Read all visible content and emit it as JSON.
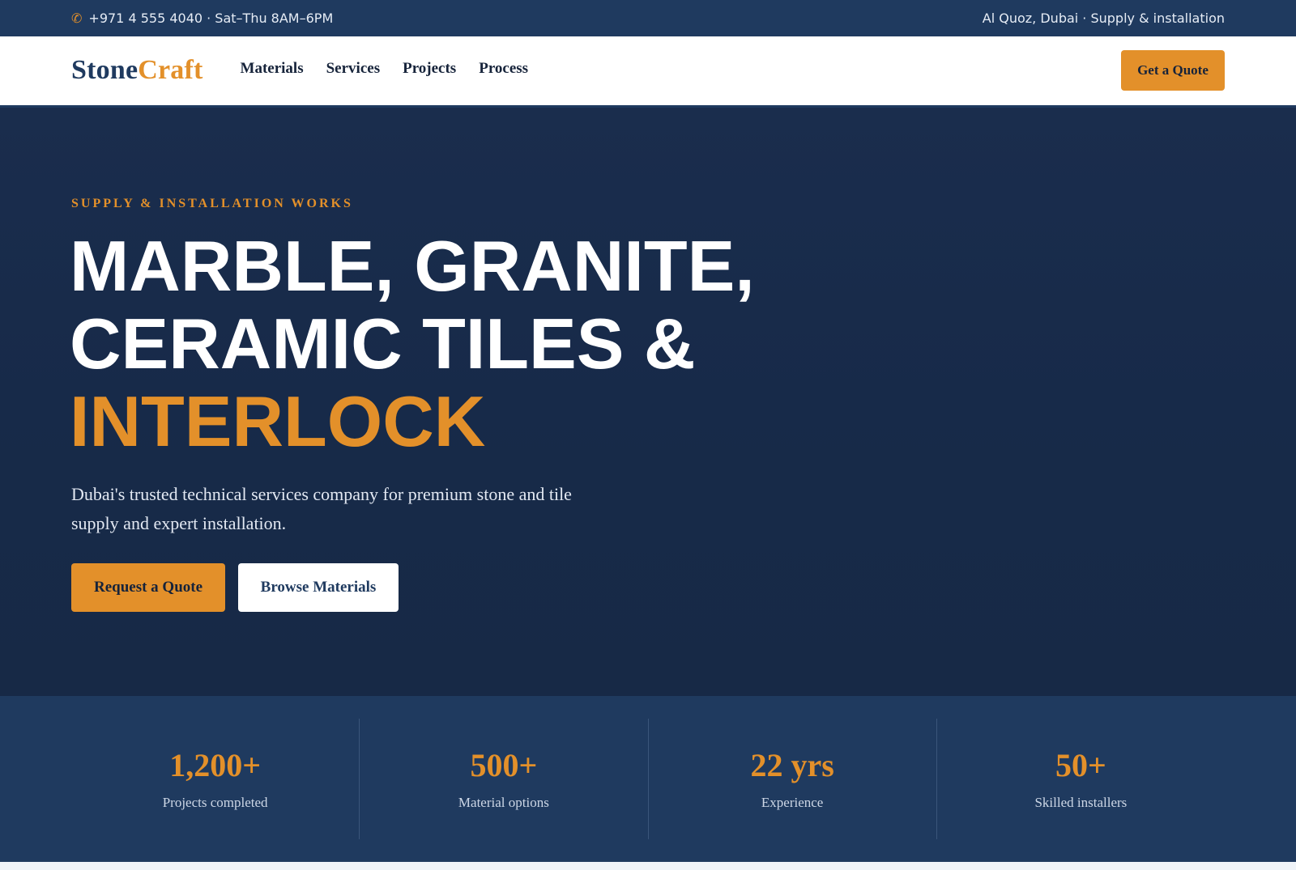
{
  "topbar": {
    "phone_icon": "phone-icon",
    "contact": "+971 4 555 4040 · Sat–Thu 8AM–6PM",
    "location": "Al Quoz, Dubai · Supply & installation"
  },
  "header": {
    "logo_part1": "Stone",
    "logo_part2": "Craft",
    "nav": [
      "Materials",
      "Services",
      "Projects",
      "Process"
    ],
    "cta": "Get a Quote"
  },
  "hero": {
    "eyebrow": "SUPPLY & INSTALLATION WORKS",
    "headline_line1": "MARBLE, GRANITE,",
    "headline_line2": "CERAMIC TILES &",
    "headline_accent": "INTERLOCK",
    "subtitle": "Dubai's trusted technical services company for premium stone and tile supply and expert installation.",
    "primary_button": "Request a Quote",
    "secondary_button": "Browse Materials"
  },
  "stats": [
    {
      "value": "1,200+",
      "label": "Projects completed"
    },
    {
      "value": "500+",
      "label": "Material options"
    },
    {
      "value": "22 yrs",
      "label": "Experience"
    },
    {
      "value": "50+",
      "label": "Skilled installers"
    }
  ],
  "colors": {
    "navy": "#1f3a5f",
    "hero_bg": "#172a49",
    "accent": "#e3902a",
    "white": "#ffffff"
  }
}
